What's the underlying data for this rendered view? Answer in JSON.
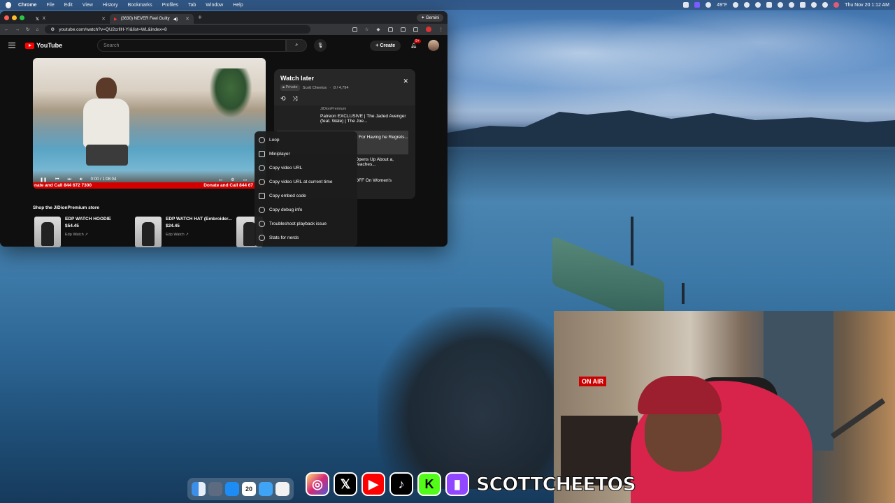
{
  "menubar": {
    "app": "Chrome",
    "items": [
      "File",
      "Edit",
      "View",
      "History",
      "Bookmarks",
      "Profiles",
      "Tab",
      "Window",
      "Help"
    ],
    "weather": "49°F",
    "datetime": "Thu Nov 20  1:12 AM"
  },
  "browser": {
    "tabs": [
      {
        "label": "X",
        "icon": "x-logo-icon"
      },
      {
        "label": "(3630) NEVER Feel Guilty",
        "icon": "youtube-icon"
      }
    ],
    "gemini_label": "Gemini",
    "url": "youtube.com/watch?v=QU2crllH-YI&list=WL&index=8"
  },
  "youtube": {
    "logo": "YouTube",
    "search_placeholder": "Search",
    "create_label": "Create",
    "notif_badge": "9+",
    "player": {
      "time": "0:00 / 1:08:04",
      "progress_fraction": 0.0,
      "banner_left": "nate and Call 844 672 7300",
      "banner_right": "Donate and Call 844 67"
    },
    "store_title": "Shop the JiDionPremium store",
    "products": [
      {
        "name": "EDP WATCH HOODIE",
        "price": "$54.45",
        "shop": "Edp Watch"
      },
      {
        "name": "EDP WATCH HAT (Embroider...",
        "price": "$24.45",
        "shop": "Edp Watch"
      }
    ],
    "watch_later": {
      "title": "Watch later",
      "privacy": "Private",
      "owner": "Scott Cheetos",
      "position": "8 / 4,794",
      "items": [
        {
          "channel": "JiDionPremium",
          "title": "Patreon EXCLUSIVE | The Jaded Avenger (feat. Wale) | The Joe..."
        },
        {
          "channel": "",
          "title": "y For Having he Regrets..."
        },
        {
          "channel": "",
          "title": "Opens Up About a, Teaches..."
        },
        {
          "channel": "",
          "title": "OFF On Women's"
        }
      ]
    },
    "context_menu": [
      {
        "label": "Loop",
        "icon": "loop-icon"
      },
      {
        "label": "Miniplayer",
        "icon": "miniplayer-icon"
      },
      {
        "label": "Copy video URL",
        "icon": "link-icon"
      },
      {
        "label": "Copy video URL at current time",
        "icon": "link-icon"
      },
      {
        "label": "Copy embed code",
        "icon": "code-icon"
      },
      {
        "label": "Copy debug info",
        "icon": "gear-icon"
      },
      {
        "label": "Troubleshoot playback issue",
        "icon": "help-icon"
      },
      {
        "label": "Stats for nerds",
        "icon": "info-icon"
      }
    ]
  },
  "webcam": {
    "on_air": "ON AIR"
  },
  "dock": {
    "calendar_day": "20"
  },
  "overlay": {
    "brand": "SCOTTCHEETOS"
  }
}
